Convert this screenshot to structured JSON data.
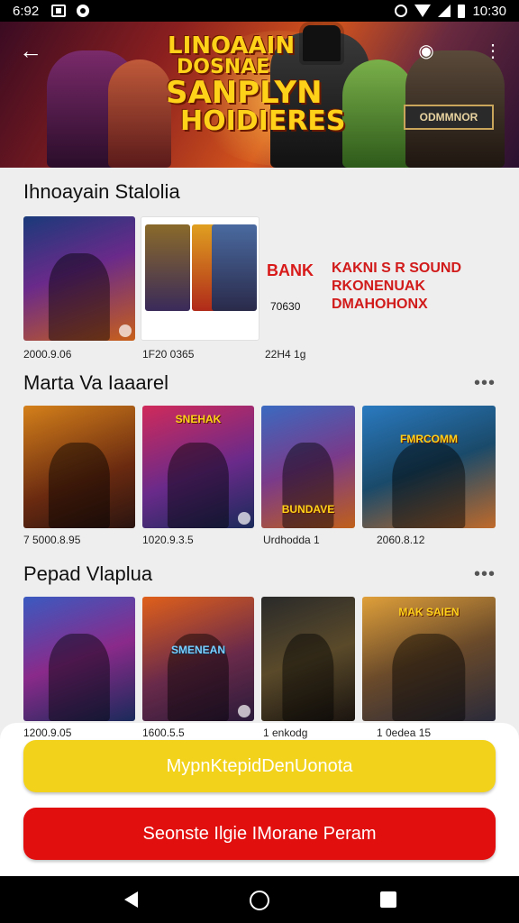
{
  "status_bar": {
    "time_left": "6:92",
    "time_right": "10:30"
  },
  "hero": {
    "title_lines": [
      "LINOAAIN",
      "DOSNAE",
      "SANPLYN",
      "HOIDIERES"
    ],
    "badge": "ODMMNOR"
  },
  "section1": {
    "title": "Ihnoayain Stalolia",
    "bank_text": "BANK",
    "bank_code": "70630",
    "promo_lines": [
      "KAKNI S R SOUND",
      "RKONENUAK",
      "DMAHOHONX"
    ],
    "captions": [
      "2000.9.06",
      "1F20 0365",
      "22H4 1g"
    ]
  },
  "section2": {
    "title": "Marta Va Iaaarel",
    "captions": [
      "7 5000.8.95",
      "1020.9.3.5",
      "Urdhodda 1",
      "2060.8.12"
    ],
    "thumb_labels": [
      "",
      "SNEHAK",
      "BUNDAVE",
      "FMRCOMM"
    ]
  },
  "section3": {
    "title": "Pepad Vlaplua",
    "captions": [
      "1200.9.05",
      "1600.5.5",
      "1 enkodg",
      "1 0edea 15"
    ],
    "thumb_labels": [
      "",
      "SMENEAN",
      "",
      "MAK SAIEN"
    ]
  },
  "actions": {
    "primary": "MypnKtepidDenUonota",
    "secondary": "Seonste Ilgie IMorane Peram"
  },
  "colors": {
    "primary_button": "#f2d21a",
    "secondary_button": "#e20f0f",
    "accent_text": "#d81a1a"
  }
}
